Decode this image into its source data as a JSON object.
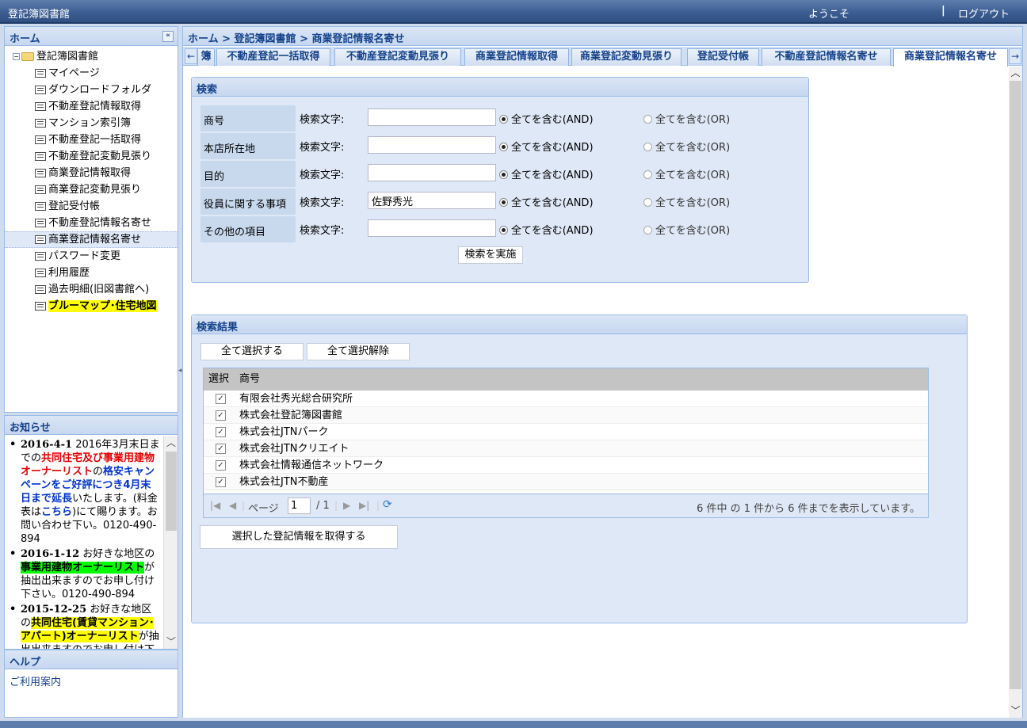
{
  "header": {
    "app_title": "登記簿図書館",
    "welcome": "ようこそ",
    "separator": "|",
    "logout": "ログアウト"
  },
  "nav": {
    "title": "ホーム",
    "collapse": "«",
    "root": "登記簿図書館",
    "items": [
      "マイページ",
      "ダウンロードフォルダ",
      "不動産登記情報取得",
      "マンション索引簿",
      "不動産登記一括取得",
      "不動産登記変動見張り",
      "商業登記情報取得",
      "商業登記変動見張り",
      "登記受付帳",
      "不動産登記情報名寄せ",
      "商業登記情報名寄せ",
      "パスワード変更",
      "利用履歴",
      "過去明細(旧図書館へ)",
      "ブルーマップ･住宅地図"
    ],
    "selected_index": 10
  },
  "news": {
    "title": "お知らせ",
    "items": [
      {
        "date": "2016-4-1",
        "t1": "2016年3月末日までの",
        "t2": "共同住宅及び事業用建物オーナーリスト",
        "t3": "の",
        "t4": "格安キャンペーンをご好評につき4月末日まで延長",
        "t5": "いたします。(料金表は",
        "t6": "こちら",
        "t7": ")にて賜ります。お問い合わせ下い。0120-490-894"
      },
      {
        "date": "2016-1-12",
        "t1": "お好きな地区の",
        "t2": "事業用建物オーナーリスト",
        "t3": "が抽出出来ますのでお申し付け下さい。0120-490-894"
      },
      {
        "date": "2015-12-25",
        "t1": "お好きな地区の",
        "t2": "共同住宅(賃貸マンション･アパート)オーナーリスト",
        "t3": "が抽出出来ますのでお申し付け下さい"
      }
    ]
  },
  "help": {
    "title": "ヘルプ",
    "link": "ご利用案内"
  },
  "breadcrumb": "ホーム > 登記簿図書館 > 商業登記情報名寄せ",
  "tabs": {
    "left_arrow": "←",
    "right_arrow": "→",
    "items": [
      "簿",
      "不動産登記一括取得",
      "不動産登記変動見張り",
      "商業登記情報取得",
      "商業登記変動見張り",
      "登記受付帳",
      "不動産登記情報名寄せ",
      "商業登記情報名寄せ"
    ],
    "active_index": 7
  },
  "search": {
    "title": "検索",
    "keyword_label": "検索文字:",
    "and_label": "全てを含む(AND)",
    "or_label": "全てを含む(OR)",
    "rows": [
      {
        "label": "商号",
        "value": ""
      },
      {
        "label": "本店所在地",
        "value": ""
      },
      {
        "label": "目的",
        "value": ""
      },
      {
        "label": "役員に関する事項",
        "value": "佐野秀光"
      },
      {
        "label": "その他の項目",
        "value": ""
      }
    ],
    "selected_mode": "AND",
    "submit": "検索を実施"
  },
  "results": {
    "title": "検索結果",
    "select_all": "全て選択する",
    "deselect_all": "全て選択解除",
    "columns": [
      "選択",
      "商号"
    ],
    "rows": [
      {
        "checked": true,
        "name": "有限会社秀光総合研究所"
      },
      {
        "checked": true,
        "name": "株式会社登記簿図書館"
      },
      {
        "checked": true,
        "name": "株式会社JTNパーク"
      },
      {
        "checked": true,
        "name": "株式会社JTNクリエイト"
      },
      {
        "checked": true,
        "name": "株式会社情報通信ネットワーク"
      },
      {
        "checked": true,
        "name": "株式会社JTN不動産"
      }
    ],
    "pager": {
      "page_label": "ページ",
      "page": "1",
      "total": "/ 1",
      "status": "6 件中 の 1 件から 6 件までを表示しています。"
    },
    "get_button": "選択した登記情報を取得する"
  }
}
